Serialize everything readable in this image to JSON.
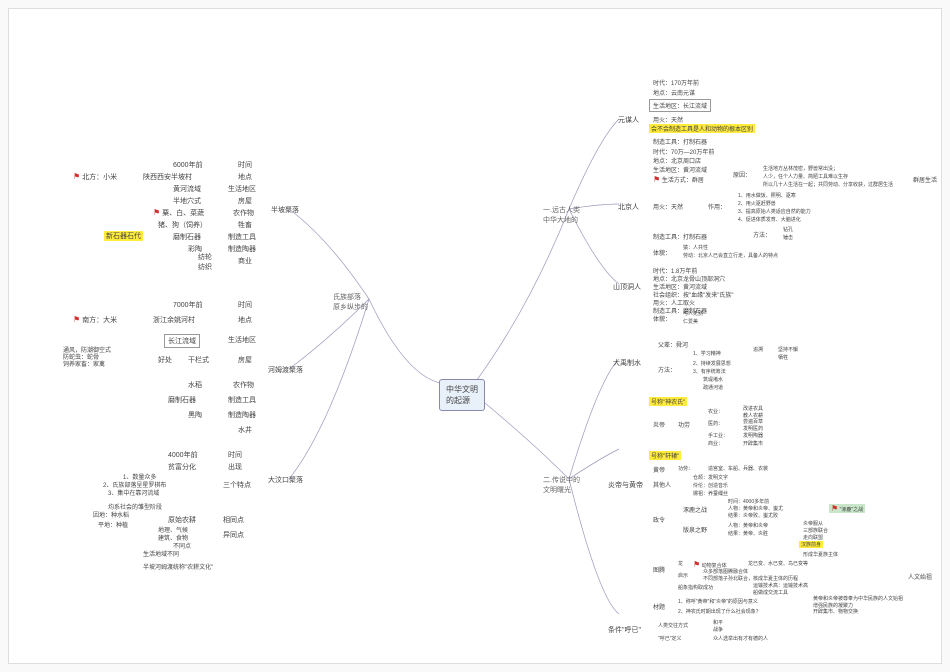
{
  "center": "中华文明\n的起源",
  "main_branches": {
    "A": "氏族部落\n原乡纵步的",
    "B": "一.远古人类\n中华大地的",
    "C": "二.传说中的\n文明曙光"
  },
  "left": {
    "hemudu": "河姆渡聚落",
    "banpo": "半坡聚落",
    "dawenkou": "大汶口聚落",
    "era": "新石器石代",
    "north": "北方：小米",
    "south": "南方：大米",
    "banpo_items": {
      "time": "时间",
      "time_v": "6000年前",
      "place": "地点",
      "place_v": "陕西西安半坡村",
      "region": "生活地区",
      "region_v": "黄河流域",
      "house": "房屋",
      "house_v": "半地穴式",
      "crop": "农作物",
      "crop_v": "粟、白、菜蔬",
      "animal": "牲畜",
      "animal_v": "猪、狗（饲养）",
      "tool": "制造工具",
      "tool_v": "磨制石器",
      "pottery": "制造陶器",
      "pottery_v": "彩陶",
      "trade": "商业",
      "trade_sub1": "纺轮",
      "trade_sub2": "纺织"
    },
    "hemudu_items": {
      "time": "时间",
      "time_v": "7000年前",
      "place": "地点",
      "place_v": "浙江余姚河村",
      "region": "生活地区",
      "region_v": "长江流域",
      "house": "房屋",
      "house_v": "干栏式",
      "house_reason": "通风，防潮御空式\n防蛇虫：蛇骨\n饲养家畜：家禽",
      "crop": "农作物",
      "crop_v": "水稻",
      "tool": "制造工具",
      "tool_v": "磨制石器",
      "pottery": "制造陶器",
      "pottery_v": "黑陶",
      "well": "水井"
    },
    "dawenkou_items": {
      "time": "时间",
      "time_v": "4000年前",
      "wealth": "出现",
      "wealth_v": "贫富分化",
      "features": "三个特点",
      "f1": "1、数量众多",
      "f2": "2、氏族部落呈星罗棋布",
      "f3": "3、集中在靠河流域",
      "equal": "均系社会的雏型阶段",
      "diff": "相同点",
      "diff_v": "原始农耕",
      "diff2": "平地：种植",
      "diff3": "异同点",
      "diff3_v1": "地理、气候",
      "diff3_v2": "建筑、食物",
      "diff3_v3": "不同点",
      "diff3_v4": "生活地域不同",
      "result": "半坡河姆渡统称\"农耕文化\""
    }
  },
  "right_top": {
    "yuanmou": "元谋人",
    "beijing": "北京人",
    "shanding": "山顶洞人",
    "ym": {
      "time": "时代：170万年前",
      "place": "地点：云南元谋",
      "region": "生活地区：长江流域",
      "fire": "用火：天然",
      "key": "会不会制造工具是人和动物的根本区别",
      "tool": "制造工具：打制石器"
    },
    "bj": {
      "time": "时代：70万—20万年前",
      "place": "地点：北京周口店",
      "region": "生活地区：黄河流域",
      "life": "生活方式：群居",
      "life_r1": "原因：",
      "life_r1a": "生活地方丛林茂密，野兽常出没；",
      "life_r1b": "人少，任个人力量、简陋工具难以生存",
      "life_r1c": "所以几十人生活在一起；共同劳动、分享收获，过群居生活",
      "side": "群居生活",
      "fire": "用火：天然",
      "fire_use": "作用：",
      "fu1": "1、用水做饭、照明、驱寒",
      "fu2": "2、用火驱赶野兽",
      "fu3": "3、提高原始人类适应自然的能力",
      "fu4": "4、促进体质发育、大脑进化",
      "tool": "制造工具：打制石器",
      "tool_m": "方法：",
      "tool_m1": "钻孔",
      "tool_m2": "锤击",
      "body": "体貌：",
      "body1": "猿：人共性",
      "body2": "劳动：北京人已会直立行走，具备人的特点"
    },
    "sd": {
      "time": "时代：1.8万年前",
      "place": "地点：北京龙骨山顶部洞穴",
      "region": "生活地区：黄河流域",
      "social": "社会组织：按\"血缘\"发来\"氏族\"",
      "fire": "用火：人工取火",
      "tool": "制造工具：磨制石器",
      "body": "体貌：",
      "body1": "与人无别",
      "body2": "仁爱美"
    }
  },
  "right_bot": {
    "dayu": "大禹制水",
    "yanhuang": "炎帝与黄帝",
    "other": "条件\"呼已\"",
    "dy": {
      "father": "父辈：舜河",
      "method": "方法：",
      "m1": "1、学习精神",
      "m1a": "追溯",
      "m1b": "坚持不懈",
      "m1c": "牺牲",
      "m2": "2、持续发展思想",
      "m3": "3、有序统筹法",
      "m4": "筑堤堵水",
      "m5": "疏通河道"
    },
    "yandi": {
      "title": "号称\"神农氏\"",
      "name": "炎帝",
      "work": "功劳",
      "w1": "农业：",
      "w1a": "改进农具",
      "w1b": "教人农耕",
      "w2": "医药：",
      "w2a": "尝遍百草",
      "w2b": "发明医药",
      "w3": "手工业：",
      "w3a": "发明陶器",
      "w4": "商业：",
      "w4a": "开辟集市"
    },
    "huangdi": {
      "title": "号称\"轩辕\"",
      "name": "黄帝",
      "work": "功劳：",
      "work_v": "造宫室、车船、兵器、衣裳",
      "others": "其他人",
      "o1": "仓颉：发明文字",
      "o2": "伶伦：创造音乐",
      "o3": "嫘祖：养蚕缫丝"
    },
    "war": {
      "branch": "政令",
      "zl": "涿鹿之战",
      "zl_t": "时间：4000多年前",
      "zl_p": "人物：黄帝和炎帝、蚩尤",
      "zl_r": "结果：炎帝败、蚩尤败",
      "zl_tag": "\"涿鹿\"之战",
      "by": "版泉之野",
      "by_p": "人物：黄帝和炎帝",
      "by_r": "结果：黄帝、炎胜",
      "by_e1": "炎帝服从",
      "by_e2": "三部族联合",
      "by_e3": "走向联盟",
      "hx": "汉族前身",
      "hx_r": "形成华夏族主体"
    },
    "totem": {
      "name": "图腾",
      "t1": "龙",
      "t1a": "动物复合体",
      "t1b": "龙已变、水已变、鸟已变等",
      "t2": "启示",
      "t2a": "众多部落图腾融合体",
      "t2b": "不同部落子孙北联合，核成华夏主体的历程",
      "t3": "船象指构取成功",
      "t3a": "运输技术高：运输技术高",
      "t3b": "船做成交流工具",
      "side": "人文始祖"
    },
    "material": {
      "name": "材题",
      "m1": "1、称呼\"黄帝\"和\"炎帝\"的原因与意义",
      "m1a": "黄帝和炎帝被尊奉为中华民族的人文始祖",
      "m1b": "增强民族的凝聚力",
      "m2": "2、神农氏时期出现了什么社会现象？",
      "m2a": "开辟集市、物物交换"
    },
    "cond": {
      "c1": "人类交往方式",
      "c1a": "和平",
      "c1b": "战争",
      "c2": "\"呼已\"定义",
      "c2a": "众人选举出有才有德的人"
    }
  }
}
